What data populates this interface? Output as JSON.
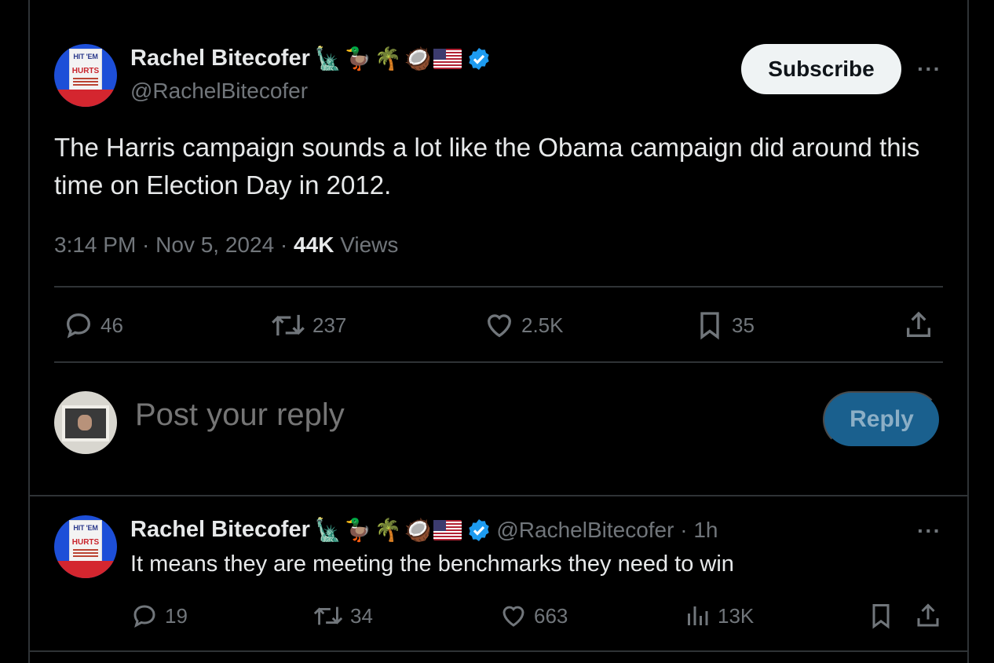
{
  "main_tweet": {
    "author": "Rachel Bitecofer",
    "handle": "@RachelBitecofer",
    "emojis": [
      "🗽",
      "🦆",
      "🌴",
      "🥥"
    ],
    "subscribe_label": "Subscribe",
    "more_label": "···",
    "text": "The Harris campaign sounds a lot like the Obama campaign did around this time on Election Day in 2012.",
    "time": "3:14 PM · Nov 5, 2024 · ",
    "views_count": "44K",
    "views_label": " Views",
    "replies": "46",
    "reposts": "237",
    "likes": "2.5K",
    "bookmarks": "35"
  },
  "composer": {
    "placeholder": "Post your reply",
    "reply_label": "Reply"
  },
  "reply_tweet": {
    "author": "Rachel Bitecofer",
    "handle": "@RachelBitecofer · 1h",
    "emojis": [
      "🗽",
      "🦆",
      "🌴",
      "🥥"
    ],
    "more_label": "···",
    "text": "It means they are meeting the benchmarks they need to win",
    "replies": "19",
    "reposts": "34",
    "likes": "663",
    "views": "13K"
  },
  "avatar_cover": {
    "title_line1": "HIT 'EM",
    "title_line2": "HURTS"
  },
  "colors": {
    "background": "#000000",
    "verified": "#1d9bf0",
    "reply_button": "#1d6b9e"
  }
}
